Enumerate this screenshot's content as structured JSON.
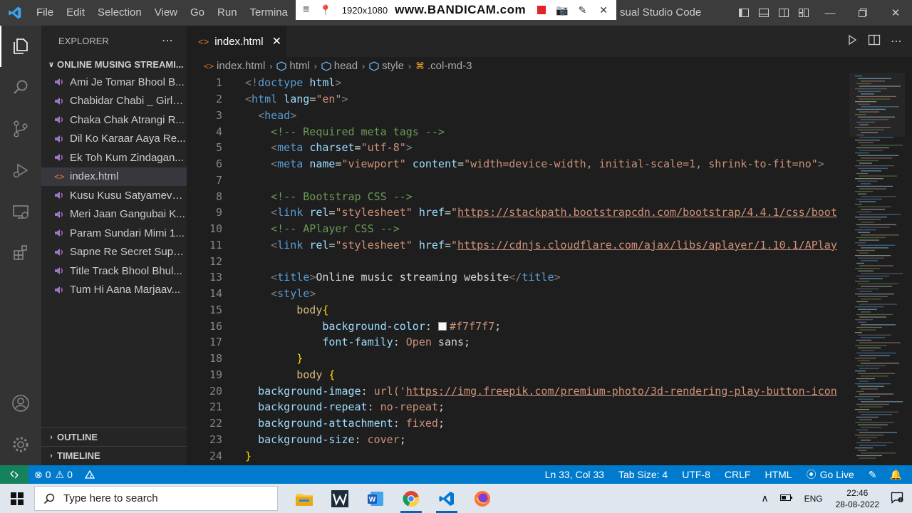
{
  "titlebar": {
    "menu": [
      "File",
      "Edit",
      "Selection",
      "View",
      "Go",
      "Run",
      "Termina"
    ],
    "title_visible": "sual Studio Code"
  },
  "bandicam": {
    "resolution": "1920x1080",
    "brand": "www.BANDICAM.com"
  },
  "sidebar": {
    "header": "EXPLORER",
    "folder": "ONLINE MUSING STREAMI...",
    "files": [
      {
        "label": "Ami Je Tomar Bhool B...",
        "icon": "audio-file-icon",
        "selected": false
      },
      {
        "label": "Chabidar Chabi _ Girlz...",
        "icon": "audio-file-icon",
        "selected": false
      },
      {
        "label": "Chaka Chak Atrangi R...",
        "icon": "audio-file-icon",
        "selected": false
      },
      {
        "label": "Dil Ko Karaar Aaya Re...",
        "icon": "audio-file-icon",
        "selected": false
      },
      {
        "label": "Ek Toh Kum Zindagan...",
        "icon": "audio-file-icon",
        "selected": false
      },
      {
        "label": "index.html",
        "icon": "html-file-icon",
        "selected": true
      },
      {
        "label": "Kusu Kusu Satyameva...",
        "icon": "audio-file-icon",
        "selected": false
      },
      {
        "label": "Meri Jaan Gangubai K...",
        "icon": "audio-file-icon",
        "selected": false
      },
      {
        "label": "Param Sundari Mimi 1...",
        "icon": "audio-file-icon",
        "selected": false
      },
      {
        "label": "Sapne Re Secret Supe...",
        "icon": "audio-file-icon",
        "selected": false
      },
      {
        "label": "Title Track Bhool Bhul...",
        "icon": "audio-file-icon",
        "selected": false
      },
      {
        "label": "Tum Hi Aana Marjaav...",
        "icon": "audio-file-icon",
        "selected": false
      }
    ],
    "outline": "OUTLINE",
    "timeline": "TIMELINE"
  },
  "editor": {
    "tab": "index.html",
    "breadcrumb": [
      "index.html",
      "html",
      "head",
      "style",
      ".col-md-3"
    ],
    "lines": [
      {
        "n": "1",
        "indent": "",
        "tokens": [
          [
            "punct",
            "<!"
          ],
          [
            "tag",
            "doctype"
          ],
          [
            "txt",
            " "
          ],
          [
            "attr",
            "html"
          ],
          [
            "punct",
            ">"
          ]
        ]
      },
      {
        "n": "2",
        "indent": "",
        "tokens": [
          [
            "punct",
            "<"
          ],
          [
            "tag",
            "html"
          ],
          [
            "txt",
            " "
          ],
          [
            "attr",
            "lang"
          ],
          [
            "txt",
            "="
          ],
          [
            "str",
            "\"en\""
          ],
          [
            "punct",
            ">"
          ]
        ]
      },
      {
        "n": "3",
        "indent": "  ",
        "tokens": [
          [
            "punct",
            "<"
          ],
          [
            "tag",
            "head"
          ],
          [
            "punct",
            ">"
          ]
        ]
      },
      {
        "n": "4",
        "indent": "    ",
        "tokens": [
          [
            "com",
            "<!-- Required meta tags -->"
          ]
        ]
      },
      {
        "n": "5",
        "indent": "    ",
        "tokens": [
          [
            "punct",
            "<"
          ],
          [
            "tag",
            "meta"
          ],
          [
            "txt",
            " "
          ],
          [
            "attr",
            "charset"
          ],
          [
            "txt",
            "="
          ],
          [
            "str",
            "\"utf-8\""
          ],
          [
            "punct",
            ">"
          ]
        ]
      },
      {
        "n": "6",
        "indent": "    ",
        "tokens": [
          [
            "punct",
            "<"
          ],
          [
            "tag",
            "meta"
          ],
          [
            "txt",
            " "
          ],
          [
            "attr",
            "name"
          ],
          [
            "txt",
            "="
          ],
          [
            "str",
            "\"viewport\""
          ],
          [
            "txt",
            " "
          ],
          [
            "attr",
            "content"
          ],
          [
            "txt",
            "="
          ],
          [
            "str",
            "\"width=device-width, initial-scale=1, shrink-to-fit=no\""
          ],
          [
            "punct",
            ">"
          ]
        ]
      },
      {
        "n": "7",
        "indent": "",
        "tokens": []
      },
      {
        "n": "8",
        "indent": "    ",
        "tokens": [
          [
            "com",
            "<!-- Bootstrap CSS -->"
          ]
        ]
      },
      {
        "n": "9",
        "indent": "    ",
        "tokens": [
          [
            "punct",
            "<"
          ],
          [
            "tag",
            "link"
          ],
          [
            "txt",
            " "
          ],
          [
            "attr",
            "rel"
          ],
          [
            "txt",
            "="
          ],
          [
            "str",
            "\"stylesheet\""
          ],
          [
            "txt",
            " "
          ],
          [
            "attr",
            "href"
          ],
          [
            "txt",
            "="
          ],
          [
            "str",
            "\""
          ],
          [
            "url",
            "https://stackpath.bootstrapcdn.com/bootstrap/4.4.1/css/boot"
          ]
        ]
      },
      {
        "n": "10",
        "indent": "    ",
        "tokens": [
          [
            "com",
            "<!-- APlayer CSS -->"
          ]
        ]
      },
      {
        "n": "11",
        "indent": "    ",
        "tokens": [
          [
            "punct",
            "<"
          ],
          [
            "tag",
            "link"
          ],
          [
            "txt",
            " "
          ],
          [
            "attr",
            "rel"
          ],
          [
            "txt",
            "="
          ],
          [
            "str",
            "\"stylesheet\""
          ],
          [
            "txt",
            " "
          ],
          [
            "attr",
            "href"
          ],
          [
            "txt",
            "="
          ],
          [
            "str",
            "\""
          ],
          [
            "url",
            "https://cdnjs.cloudflare.com/ajax/libs/aplayer/1.10.1/APlay"
          ]
        ]
      },
      {
        "n": "12",
        "indent": "",
        "tokens": []
      },
      {
        "n": "13",
        "indent": "    ",
        "tokens": [
          [
            "punct",
            "<"
          ],
          [
            "tag",
            "title"
          ],
          [
            "punct",
            ">"
          ],
          [
            "txt",
            "Online music streaming website"
          ],
          [
            "punct",
            "</"
          ],
          [
            "tag",
            "title"
          ],
          [
            "punct",
            ">"
          ]
        ]
      },
      {
        "n": "14",
        "indent": "    ",
        "tokens": [
          [
            "punct",
            "<"
          ],
          [
            "tag",
            "style"
          ],
          [
            "punct",
            ">"
          ]
        ]
      },
      {
        "n": "15",
        "indent": "        ",
        "tokens": [
          [
            "sel",
            "body"
          ],
          [
            "brace",
            "{"
          ]
        ]
      },
      {
        "n": "16",
        "indent": "            ",
        "tokens": [
          [
            "attr",
            "background-color"
          ],
          [
            "txt",
            ": "
          ],
          [
            "swatch",
            ""
          ],
          [
            "str",
            "#f7f7f7"
          ],
          [
            "txt",
            ";"
          ]
        ]
      },
      {
        "n": "17",
        "indent": "            ",
        "tokens": [
          [
            "attr",
            "font-family"
          ],
          [
            "txt",
            ": "
          ],
          [
            "str",
            "Open"
          ],
          [
            "txt",
            " sans;"
          ]
        ]
      },
      {
        "n": "18",
        "indent": "        ",
        "tokens": [
          [
            "brace",
            "}"
          ]
        ]
      },
      {
        "n": "19",
        "indent": "        ",
        "tokens": [
          [
            "sel",
            "body"
          ],
          [
            "txt",
            " "
          ],
          [
            "brace",
            "{"
          ]
        ]
      },
      {
        "n": "20",
        "indent": "  ",
        "tokens": [
          [
            "attr",
            "background-image"
          ],
          [
            "txt",
            ": "
          ],
          [
            "str",
            "url("
          ],
          [
            "str",
            "'"
          ],
          [
            "url",
            "https://img.freepik.com/premium-photo/3d-rendering-play-button-icon"
          ]
        ]
      },
      {
        "n": "21",
        "indent": "  ",
        "tokens": [
          [
            "attr",
            "background-repeat"
          ],
          [
            "txt",
            ": "
          ],
          [
            "str",
            "no-repeat"
          ],
          [
            "txt",
            ";"
          ]
        ]
      },
      {
        "n": "22",
        "indent": "  ",
        "tokens": [
          [
            "attr",
            "background-attachment"
          ],
          [
            "txt",
            ": "
          ],
          [
            "str",
            "fixed"
          ],
          [
            "txt",
            ";"
          ]
        ]
      },
      {
        "n": "23",
        "indent": "  ",
        "tokens": [
          [
            "attr",
            "background-size"
          ],
          [
            "txt",
            ": "
          ],
          [
            "str",
            "cover"
          ],
          [
            "txt",
            ";"
          ]
        ]
      },
      {
        "n": "24",
        "indent": "",
        "tokens": [
          [
            "brace",
            "}"
          ]
        ]
      }
    ]
  },
  "statusbar": {
    "errors": "0",
    "warnings": "0",
    "position": "Ln 33, Col 33",
    "tab_size": "Tab Size: 4",
    "encoding": "UTF-8",
    "eol": "CRLF",
    "language": "HTML",
    "go_live": "Go Live"
  },
  "taskbar": {
    "search_placeholder": "Type here to search",
    "language": "ENG",
    "time": "22:46",
    "date": "28-08-2022"
  },
  "colors": {
    "accent": "#007acc",
    "remote": "#16825d",
    "titlebar": "#3c3c3c",
    "editor_bg": "#1e1e1e"
  }
}
